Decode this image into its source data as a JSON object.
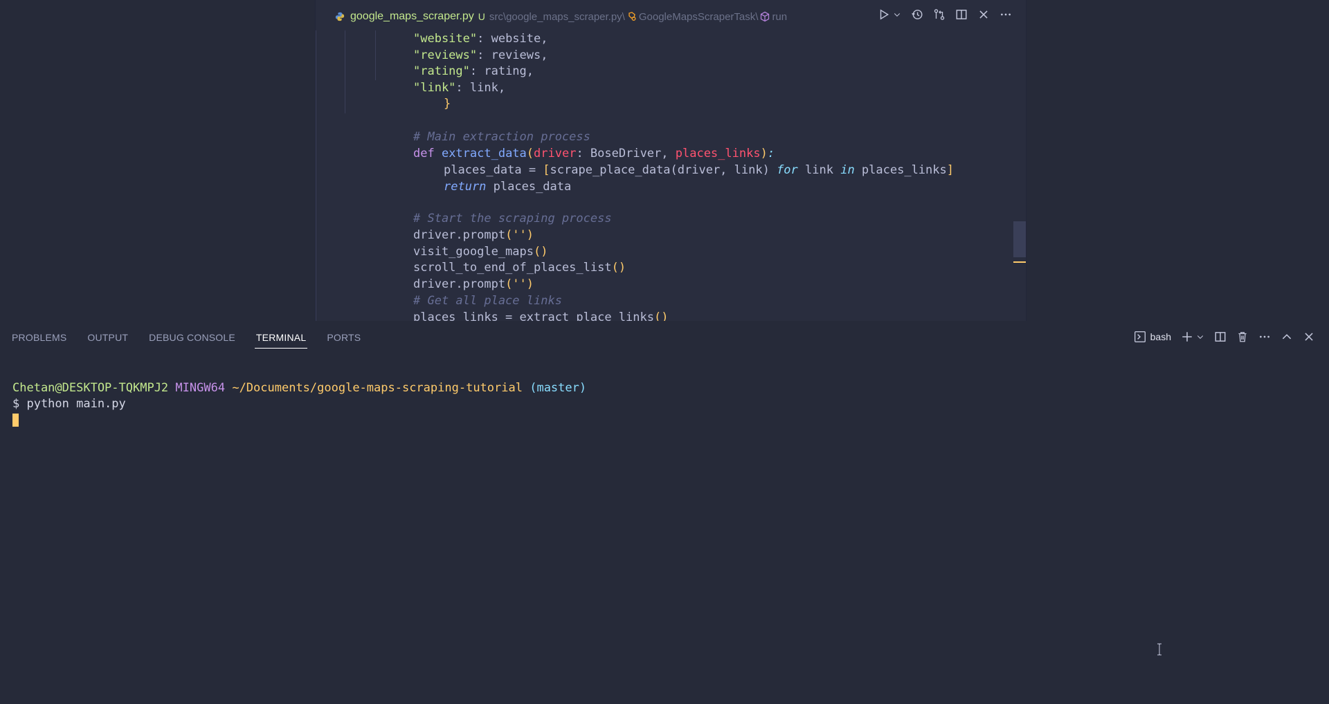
{
  "editor": {
    "tab": {
      "filename": "google_maps_scraper.py",
      "status": "U",
      "breadcrumb_path": "src\\google_maps_scraper.py\\",
      "breadcrumb_class": "GoogleMapsScraperTask\\",
      "breadcrumb_method": "run"
    },
    "actions": [
      "run-icon",
      "chevron-down-icon",
      "history-icon",
      "compare-changes-icon",
      "split-editor-icon",
      "close-icon",
      "more-icon"
    ],
    "code": {
      "l1_key": "\"website\"",
      "l1_rest": ": website,",
      "l2_key": "\"reviews\"",
      "l2_rest": ": reviews,",
      "l3_key": "\"rating\"",
      "l3_rest": ": rating,",
      "l4_key": "\"link\"",
      "l4_rest": ": link,",
      "l5": "}",
      "l7": "# Main extraction process",
      "l8_def": "def ",
      "l8_fn": "extract_data",
      "l8_open": "(",
      "l8_p1": "driver",
      "l8_mid": ": BoseDriver, ",
      "l8_p2": "places_links",
      "l8_close": ")",
      "l8_colon": ":",
      "l9_a": "places_data = ",
      "l9_ob": "[",
      "l9_b": "scrape_place_data(driver, link) ",
      "l9_for": "for",
      "l9_c": " link ",
      "l9_in": "in",
      "l9_d": " places_links",
      "l9_cb": "]",
      "l10_ret": "return",
      "l10_rest": " places_data",
      "l12": "# Start the scraping process",
      "l13_a": "driver.prompt",
      "l13_b": "('')",
      "l14_a": "visit_google_maps",
      "l14_b": "()",
      "l15_a": "scroll_to_end_of_places_list",
      "l15_b": "()",
      "l16_a": "driver.prompt",
      "l16_b": "('')",
      "l17": "# Get all place links",
      "l18_a": "places_links = extract_place_links",
      "l18_b": "()"
    }
  },
  "panel": {
    "tabs": [
      "PROBLEMS",
      "OUTPUT",
      "DEBUG CONSOLE",
      "TERMINAL",
      "PORTS"
    ],
    "active_tab": "TERMINAL",
    "terminal_profile": "bash"
  },
  "terminal": {
    "user": "Chetan@DESKTOP-TQKMPJ2",
    "system": "MINGW64",
    "path": "~/Documents/google-maps-scraping-tutorial",
    "branch": "(master)",
    "command": "$ python main.py"
  },
  "colors": {
    "background": "#262a39",
    "editor_bg": "#292d3e",
    "string": "#c3e88d",
    "comment": "#676e95",
    "keyword": "#c792ea",
    "function": "#82aaff",
    "parameter": "#ff5370",
    "bracket": "#ffcb6b",
    "cursor": "#ffcb6b"
  }
}
